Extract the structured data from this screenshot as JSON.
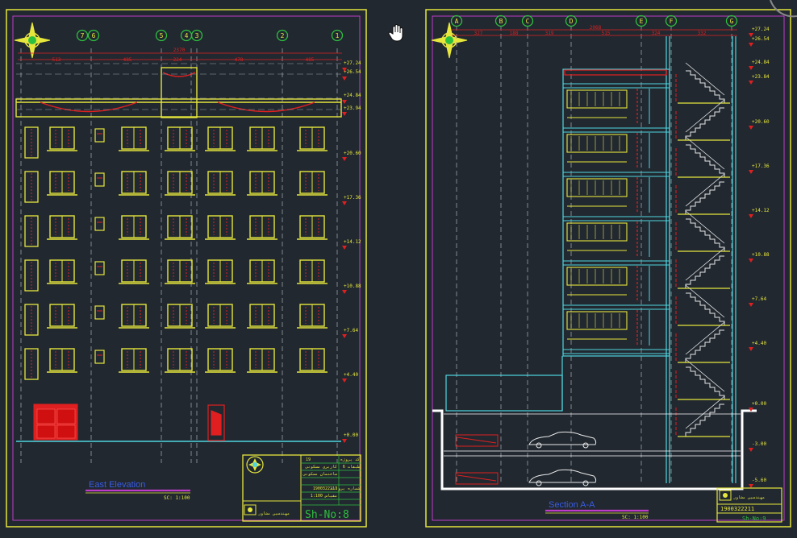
{
  "left_sheet": {
    "title": "East Elevation",
    "scale": "SC: 1:100",
    "sheet_no": "Sh-No:8",
    "axis_labels": [
      "7",
      "6",
      "5",
      "4",
      "3",
      "2",
      "1"
    ],
    "dims_total": "2370",
    "dims_segments": [
      "513",
      "485",
      "224",
      "478",
      "485"
    ],
    "levels": [
      "+27.24",
      "+26.54",
      "+24.84",
      "+23.94",
      "+20.60",
      "+17.36",
      "+14.12",
      "+10.88",
      "+7.64",
      "+4.40",
      "+0.00"
    ]
  },
  "right_sheet": {
    "title": "Section  A-A",
    "scale": "SC: 1:100",
    "sheet_no": "Sh-No:9",
    "project_no": "1900322211",
    "axis_labels": [
      "A",
      "B",
      "C",
      "D",
      "E",
      "F",
      "G"
    ],
    "dims_total": "2068",
    "dims_segments": [
      "327",
      "188",
      "319",
      "515",
      "324",
      "332"
    ],
    "levels": [
      "+27.24",
      "+26.54",
      "+24.84",
      "+23.84",
      "+20.60",
      "+17.36",
      "+14.12",
      "+10.88",
      "+7.64",
      "+4.40",
      "+0.00",
      "-3.00",
      "-5.60"
    ]
  },
  "title_block": {
    "rows": [
      "19",
      "کد پروژه",
      "کاربری مسکونی",
      "طبقات 6",
      "ساختمان مسکونی",
      "شماره پروانه",
      "1900322211",
      "مقیاس 1:100"
    ],
    "sheet_no": "Sh-No:8",
    "firm": "مهندسین مشاور"
  },
  "colors": {
    "background": "#212830",
    "line_yellow": "#e6e63c",
    "line_cyan": "#4fd6e0",
    "line_red": "#e02020",
    "line_green": "#2fbf3f",
    "line_white": "#ffffff",
    "line_magenta": "#c03cc8"
  },
  "cursor_icon": "hand-pan-icon"
}
